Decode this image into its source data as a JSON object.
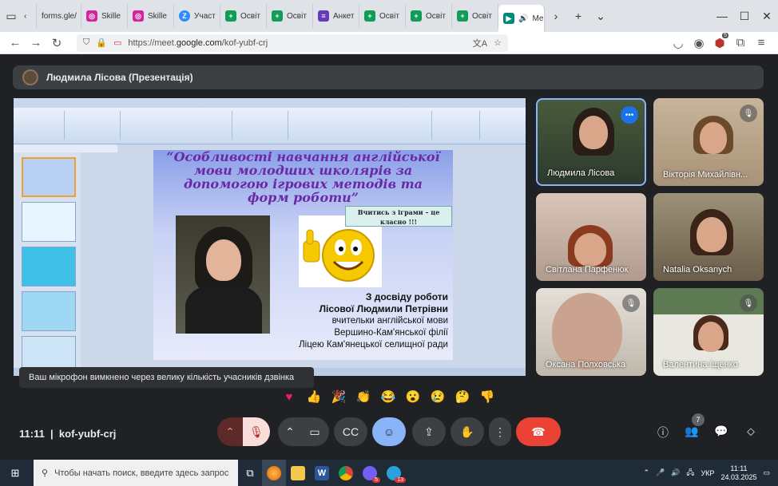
{
  "browser": {
    "tabs": [
      {
        "label": "",
        "icon": "tab-list-icon"
      },
      {
        "label": "forms.gle/",
        "icon": "page-icon"
      },
      {
        "label": "Skille",
        "icon": "instagram-icon",
        "color": "#d6249f"
      },
      {
        "label": "Skille",
        "icon": "instagram-icon",
        "color": "#d6249f"
      },
      {
        "label": "Участ",
        "icon": "zoom-icon",
        "color": "#2d8cff"
      },
      {
        "label": "Освіт",
        "icon": "plus-icon",
        "color": "#0f9d58"
      },
      {
        "label": "Освіт",
        "icon": "plus-icon",
        "color": "#0f9d58"
      },
      {
        "label": "Анкет",
        "icon": "forms-icon",
        "color": "#673ab7"
      },
      {
        "label": "Освіт",
        "icon": "plus-icon",
        "color": "#0f9d58"
      },
      {
        "label": "Освіт",
        "icon": "plus-icon",
        "color": "#0f9d58"
      },
      {
        "label": "Освіт",
        "icon": "plus-icon",
        "color": "#0f9d58"
      },
      {
        "label": "Ме",
        "icon": "meet-icon",
        "color": "#00897b"
      }
    ],
    "url_prefix": "https://meet.",
    "url_domain": "google.com",
    "url_path": "/kof-yubf-crj",
    "extension_badge": "5"
  },
  "meet": {
    "presenter_label": "Людмила Лісова (Презентація)",
    "slide": {
      "title": "“Особливості навчання англійської мови молодших школярів за допомогою ігрових методів та форм роботи”",
      "callout": "Вчитись з іграми – це класно !!!",
      "credit_heading": "З досвіду роботи",
      "credit_name": "Лісової Людмили Петрівни",
      "credit_line1": "вчительки англійської мови",
      "credit_line2": "Вершино-Кам'янської філії",
      "credit_line3": "Ліцею Кам'янецької селищної ради"
    },
    "participants": [
      {
        "name": "Людмила Лісова",
        "speaking": true
      },
      {
        "name": "Вікторія Михайлівн...",
        "muted": true
      },
      {
        "name": "Світлана Парфенюк"
      },
      {
        "name": "Natalia Oksanych"
      },
      {
        "name": "Оксана Полховська",
        "muted": true
      },
      {
        "name": "Валентина Іщенко",
        "muted": true
      }
    ],
    "toast": "Ваш мікрофон вимкнено через велику кількість учасників дзвінка",
    "reactions": [
      "sparkling-heart",
      "thumbs-up",
      "party-popper",
      "clapping-hands",
      "laughing-face",
      "surprised-face",
      "sad-face",
      "thinking-face",
      "thumbs-down"
    ],
    "time": "11:11",
    "code": "kof-yubf-crj",
    "people_count": "7",
    "end_call_color": "#ea4335",
    "active_color": "#8ab4f8"
  },
  "taskbar": {
    "search_placeholder": "Чтобы начать поиск, введите здесь запрос",
    "badges": [
      "5",
      "13"
    ],
    "lang": "УКР",
    "time": "11:11",
    "date": "24.03.2025"
  }
}
